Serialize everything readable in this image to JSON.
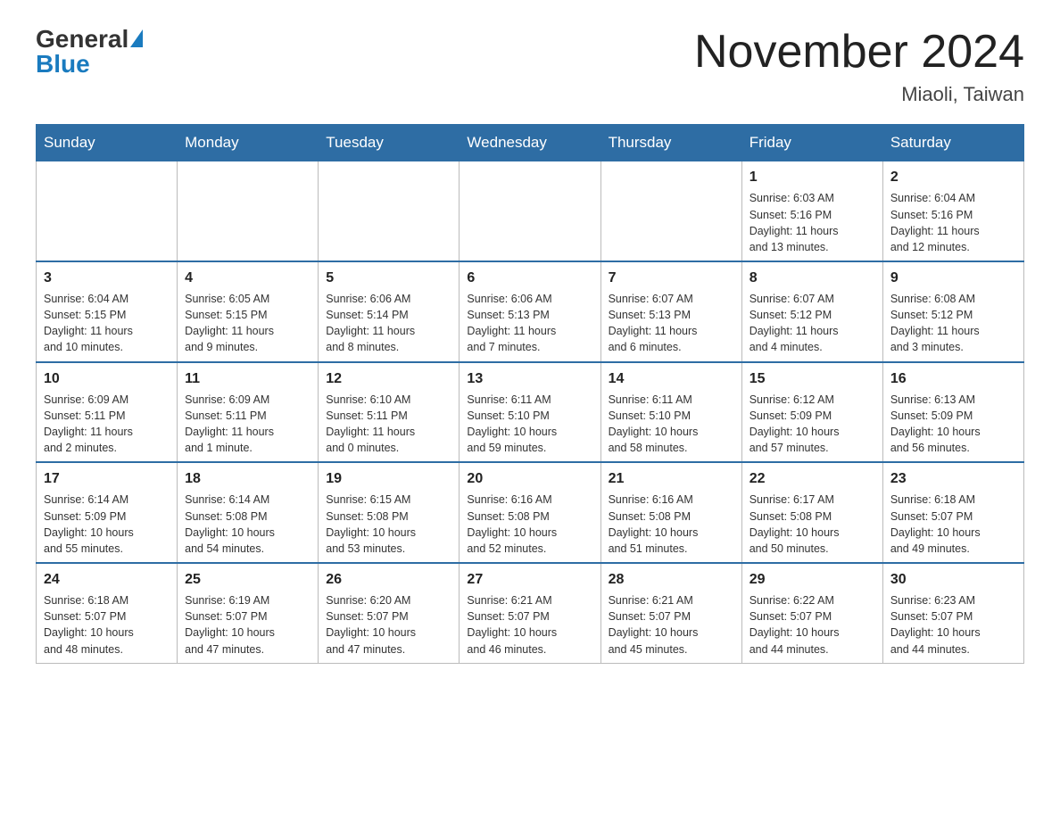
{
  "logo": {
    "general_text": "General",
    "blue_text": "Blue"
  },
  "title": "November 2024",
  "location": "Miaoli, Taiwan",
  "weekdays": [
    "Sunday",
    "Monday",
    "Tuesday",
    "Wednesday",
    "Thursday",
    "Friday",
    "Saturday"
  ],
  "weeks": [
    [
      {
        "day": "",
        "info": ""
      },
      {
        "day": "",
        "info": ""
      },
      {
        "day": "",
        "info": ""
      },
      {
        "day": "",
        "info": ""
      },
      {
        "day": "",
        "info": ""
      },
      {
        "day": "1",
        "info": "Sunrise: 6:03 AM\nSunset: 5:16 PM\nDaylight: 11 hours\nand 13 minutes."
      },
      {
        "day": "2",
        "info": "Sunrise: 6:04 AM\nSunset: 5:16 PM\nDaylight: 11 hours\nand 12 minutes."
      }
    ],
    [
      {
        "day": "3",
        "info": "Sunrise: 6:04 AM\nSunset: 5:15 PM\nDaylight: 11 hours\nand 10 minutes."
      },
      {
        "day": "4",
        "info": "Sunrise: 6:05 AM\nSunset: 5:15 PM\nDaylight: 11 hours\nand 9 minutes."
      },
      {
        "day": "5",
        "info": "Sunrise: 6:06 AM\nSunset: 5:14 PM\nDaylight: 11 hours\nand 8 minutes."
      },
      {
        "day": "6",
        "info": "Sunrise: 6:06 AM\nSunset: 5:13 PM\nDaylight: 11 hours\nand 7 minutes."
      },
      {
        "day": "7",
        "info": "Sunrise: 6:07 AM\nSunset: 5:13 PM\nDaylight: 11 hours\nand 6 minutes."
      },
      {
        "day": "8",
        "info": "Sunrise: 6:07 AM\nSunset: 5:12 PM\nDaylight: 11 hours\nand 4 minutes."
      },
      {
        "day": "9",
        "info": "Sunrise: 6:08 AM\nSunset: 5:12 PM\nDaylight: 11 hours\nand 3 minutes."
      }
    ],
    [
      {
        "day": "10",
        "info": "Sunrise: 6:09 AM\nSunset: 5:11 PM\nDaylight: 11 hours\nand 2 minutes."
      },
      {
        "day": "11",
        "info": "Sunrise: 6:09 AM\nSunset: 5:11 PM\nDaylight: 11 hours\nand 1 minute."
      },
      {
        "day": "12",
        "info": "Sunrise: 6:10 AM\nSunset: 5:11 PM\nDaylight: 11 hours\nand 0 minutes."
      },
      {
        "day": "13",
        "info": "Sunrise: 6:11 AM\nSunset: 5:10 PM\nDaylight: 10 hours\nand 59 minutes."
      },
      {
        "day": "14",
        "info": "Sunrise: 6:11 AM\nSunset: 5:10 PM\nDaylight: 10 hours\nand 58 minutes."
      },
      {
        "day": "15",
        "info": "Sunrise: 6:12 AM\nSunset: 5:09 PM\nDaylight: 10 hours\nand 57 minutes."
      },
      {
        "day": "16",
        "info": "Sunrise: 6:13 AM\nSunset: 5:09 PM\nDaylight: 10 hours\nand 56 minutes."
      }
    ],
    [
      {
        "day": "17",
        "info": "Sunrise: 6:14 AM\nSunset: 5:09 PM\nDaylight: 10 hours\nand 55 minutes."
      },
      {
        "day": "18",
        "info": "Sunrise: 6:14 AM\nSunset: 5:08 PM\nDaylight: 10 hours\nand 54 minutes."
      },
      {
        "day": "19",
        "info": "Sunrise: 6:15 AM\nSunset: 5:08 PM\nDaylight: 10 hours\nand 53 minutes."
      },
      {
        "day": "20",
        "info": "Sunrise: 6:16 AM\nSunset: 5:08 PM\nDaylight: 10 hours\nand 52 minutes."
      },
      {
        "day": "21",
        "info": "Sunrise: 6:16 AM\nSunset: 5:08 PM\nDaylight: 10 hours\nand 51 minutes."
      },
      {
        "day": "22",
        "info": "Sunrise: 6:17 AM\nSunset: 5:08 PM\nDaylight: 10 hours\nand 50 minutes."
      },
      {
        "day": "23",
        "info": "Sunrise: 6:18 AM\nSunset: 5:07 PM\nDaylight: 10 hours\nand 49 minutes."
      }
    ],
    [
      {
        "day": "24",
        "info": "Sunrise: 6:18 AM\nSunset: 5:07 PM\nDaylight: 10 hours\nand 48 minutes."
      },
      {
        "day": "25",
        "info": "Sunrise: 6:19 AM\nSunset: 5:07 PM\nDaylight: 10 hours\nand 47 minutes."
      },
      {
        "day": "26",
        "info": "Sunrise: 6:20 AM\nSunset: 5:07 PM\nDaylight: 10 hours\nand 47 minutes."
      },
      {
        "day": "27",
        "info": "Sunrise: 6:21 AM\nSunset: 5:07 PM\nDaylight: 10 hours\nand 46 minutes."
      },
      {
        "day": "28",
        "info": "Sunrise: 6:21 AM\nSunset: 5:07 PM\nDaylight: 10 hours\nand 45 minutes."
      },
      {
        "day": "29",
        "info": "Sunrise: 6:22 AM\nSunset: 5:07 PM\nDaylight: 10 hours\nand 44 minutes."
      },
      {
        "day": "30",
        "info": "Sunrise: 6:23 AM\nSunset: 5:07 PM\nDaylight: 10 hours\nand 44 minutes."
      }
    ]
  ]
}
